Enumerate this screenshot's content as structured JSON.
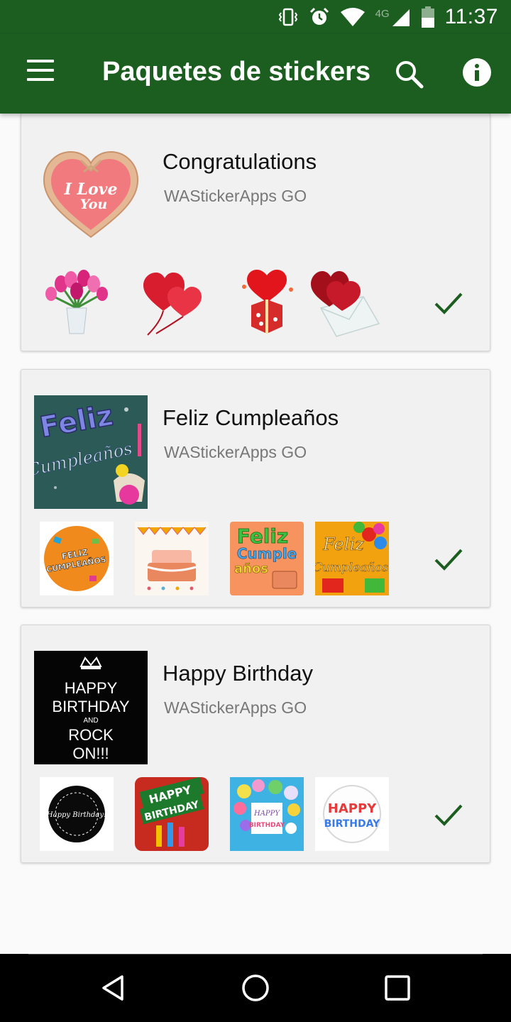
{
  "status_bar": {
    "time": "11:37",
    "network": "4G",
    "icons": [
      "vibrate-icon",
      "alarm-icon",
      "wifi-icon",
      "signal-icon",
      "battery-icon"
    ]
  },
  "app_bar": {
    "title": "Paquetes de stickers",
    "menu_icon": "menu-icon",
    "search_icon": "search-icon",
    "info_icon": "info-icon",
    "color": "#1b5e20"
  },
  "packs": [
    {
      "name": "Congratulations",
      "author": "WAStickerApps GO",
      "tray_text": [
        "I Love",
        "You"
      ],
      "stickers": [
        "tulip-bouquet-sticker",
        "red-heart-balloons-sticker",
        "heart-gift-box-sticker",
        "hearts-envelope-sticker"
      ],
      "added": true
    },
    {
      "name": "Feliz Cumpleaños",
      "author": "WAStickerApps GO",
      "tray_text": [
        "Feliz",
        "Cumpleaños"
      ],
      "stickers": [
        "feliz-cumpleanos-badge-sticker",
        "birthday-cake-bunting-sticker",
        "feliz-cumple-anos-cake-sticker",
        "feliz-cumpleanos-balloons-sticker"
      ],
      "sticker_text": [
        "FELIZ CUMPLEAÑOS",
        "",
        "Feliz Cumple años",
        "Feliz Cumpleaños"
      ],
      "added": true
    },
    {
      "name": "Happy Birthday",
      "author": "WAStickerApps GO",
      "tray_text": [
        "HAPPY",
        "BIRTHDAY",
        "AND",
        "ROCK",
        "ON!!!"
      ],
      "stickers": [
        "happy-birthday-ornament-sticker",
        "happy-birthday-banner-sticker",
        "happy-birthday-balloons-sticker",
        "happy-birthday-circle-sticker"
      ],
      "sticker_text": [
        "Happy Birthday!",
        "HAPPY BIRTHDAY",
        "HAPPY BIRTHDAY",
        "HAPPY BIRTHDAY"
      ],
      "added": true
    }
  ],
  "accent": "#1b5e20",
  "nav_bar": {
    "icons": [
      "back-icon",
      "home-icon",
      "recents-icon"
    ]
  }
}
